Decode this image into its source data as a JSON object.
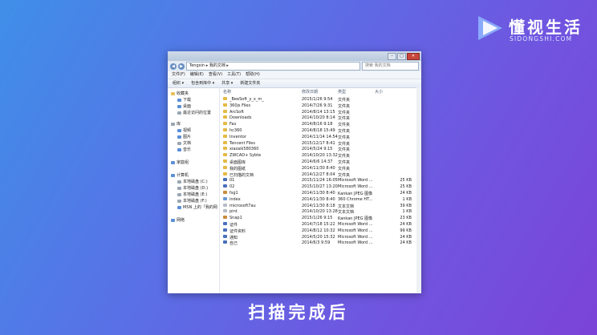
{
  "logo": {
    "text_cn": "懂视生活",
    "text_en": "SIDONGSHI.COM",
    "color": "#5b8ef0"
  },
  "caption": "扫描完成后",
  "window": {
    "breadcrumb": "Tengxin ▸ 我的文档 ▸",
    "search_placeholder": "搜索 我的文档",
    "menu": [
      "文件(F)",
      "编辑(E)",
      "查看(V)",
      "工具(T)",
      "帮助(H)"
    ],
    "toolbar": [
      "组织 ▾",
      "包含到库中 ▾",
      "共享 ▾",
      "新建文件夹"
    ],
    "nav": {
      "favorites": "收藏夹",
      "fav_items": [
        "下载",
        "桌面",
        "最近访问的位置"
      ],
      "libraries": "库",
      "lib_items": [
        "视频",
        "图片",
        "文档",
        "音乐"
      ],
      "homegroup": "家庭组",
      "computer": "计算机",
      "drives": [
        "本地磁盘 (C:)",
        "本地磁盘 (D:)",
        "本地磁盘 (E:)",
        "本地磁盘 (F:)",
        "MSN 上的「我的网"
      ],
      "network": "网络"
    },
    "columns": {
      "name": "名称",
      "date": "修改日期",
      "type": "类型",
      "size": "大小"
    },
    "files": [
      {
        "name": "_BeeSoft_y_x_m_",
        "date": "2015/1/26 9:54",
        "type": "文件夹",
        "size": "",
        "icon": "folder"
      },
      {
        "name": "360js Files",
        "date": "2014/7/26 9:31",
        "type": "文件夹",
        "size": "",
        "icon": "folder"
      },
      {
        "name": "ArcSoft",
        "date": "2014/8/14 13:15",
        "type": "文件夹",
        "size": "",
        "icon": "folder"
      },
      {
        "name": "Downloads",
        "date": "2014/10/20 8:14",
        "type": "文件夹",
        "size": "",
        "icon": "folder"
      },
      {
        "name": "Fax",
        "date": "2014/8/16 9:18",
        "type": "文件夹",
        "size": "",
        "icon": "folder"
      },
      {
        "name": "hc360",
        "date": "2014/8/18 15:49",
        "type": "文件夹",
        "size": "",
        "icon": "folder"
      },
      {
        "name": "Inventor",
        "date": "2014/11/14 14:54",
        "type": "文件夹",
        "size": "",
        "icon": "folder"
      },
      {
        "name": "Tencent Files",
        "date": "2015/12/17 8:41",
        "type": "文件夹",
        "size": "",
        "icon": "folder"
      },
      {
        "name": "xiazaik580360",
        "date": "2014/5/24 9:15",
        "type": "文件夹",
        "size": "",
        "icon": "folder"
      },
      {
        "name": "ZWCAD+ Sybte",
        "date": "2014/10/20 13:32",
        "type": "文件夹",
        "size": "",
        "icon": "folder"
      },
      {
        "name": "桌面图库",
        "date": "2014/6/6 14:37",
        "type": "文件夹",
        "size": "",
        "icon": "folder"
      },
      {
        "name": "我的图纸",
        "date": "2014/11/30 8:40",
        "type": "文件夹",
        "size": "",
        "icon": "folder"
      },
      {
        "name": "已扫描的文档",
        "date": "2014/12/27 8:04",
        "type": "文件夹",
        "size": "",
        "icon": "folder"
      },
      {
        "name": "01",
        "date": "2015/11/24 16:05",
        "type": "Microsoft Word ...",
        "size": "25 KB",
        "icon": "doc"
      },
      {
        "name": "02",
        "date": "2015/10/27 13:20",
        "type": "Microsoft Word ...",
        "size": "25 KB",
        "icon": "doc"
      },
      {
        "name": "fsg1",
        "date": "2014/11/30 8:40",
        "type": "Kankan JPEG 图像",
        "size": "24 KB",
        "icon": "img"
      },
      {
        "name": "index",
        "date": "2014/11/30 8:40",
        "type": "360 Chrome HT...",
        "size": "1 KB",
        "icon": "web"
      },
      {
        "name": "microsoft7au",
        "date": "2014/11/30 8:18",
        "type": "文本文档",
        "size": "39 KB",
        "icon": "txt"
      },
      {
        "name": "pint",
        "date": "2014/10/20 13:28",
        "type": "文本文档",
        "size": "1 KB",
        "icon": "txt"
      },
      {
        "name": "Snap1",
        "date": "2015/1/26 9:15",
        "type": "Kankan JPEG 图像",
        "size": "23 KB",
        "icon": "img"
      },
      {
        "name": "证件",
        "date": "2014/7/18 15:22",
        "type": "Microsoft Word ...",
        "size": "24 KB",
        "icon": "doc"
      },
      {
        "name": "证件资料",
        "date": "2014/8/12 10:32",
        "type": "Microsoft Word ...",
        "size": "99 KB",
        "icon": "doc"
      },
      {
        "name": "通知",
        "date": "2014/5/20 15:32",
        "type": "Microsoft Word ...",
        "size": "24 KB",
        "icon": "doc"
      },
      {
        "name": "自己",
        "date": "2014/6/3 9:59",
        "type": "Microsoft Word ...",
        "size": "24 KB",
        "icon": "doc"
      }
    ]
  }
}
